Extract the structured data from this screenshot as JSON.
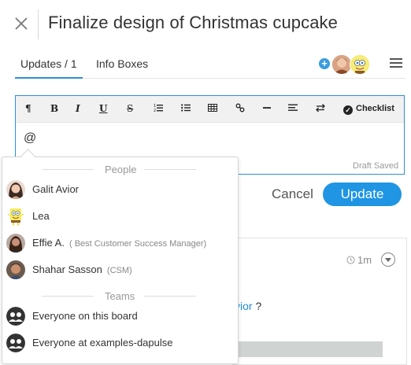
{
  "header": {
    "title": "Finalize design of Christmas cupcake"
  },
  "tabs": [
    {
      "label": "Updates / 1",
      "active": true
    },
    {
      "label": "Info Boxes",
      "active": false
    }
  ],
  "subscribers": {
    "add_symbol": "+"
  },
  "editor": {
    "toolbar": {
      "paragraph": "¶",
      "bold": "B",
      "italic": "I",
      "underline": "U",
      "strike": "S",
      "ordered_list": "≡",
      "bullet_list": "☰",
      "table": "▦",
      "link": "🔗",
      "hr": "—",
      "align": "≡",
      "direction": "⇄",
      "checklist_label": "Checklist"
    },
    "value": "@",
    "status": "Draft Saved"
  },
  "actions": {
    "cancel_label": "Cancel",
    "update_label": "Update"
  },
  "card": {
    "time": "1m",
    "text_prefix": "",
    "text_link": "vior",
    "text_suffix": " ?"
  },
  "mentions": {
    "people_heading": "People",
    "teams_heading": "Teams",
    "people": [
      {
        "name": "Galit Avior",
        "title": ""
      },
      {
        "name": "Lea",
        "title": ""
      },
      {
        "name": "Effie A.",
        "title": "( Best Customer Success Manager)"
      },
      {
        "name": "Shahar Sasson",
        "title": "(CSM)"
      }
    ],
    "teams": [
      {
        "name": "Everyone on this board"
      },
      {
        "name": "Everyone at examples-dapulse"
      }
    ]
  },
  "colors": {
    "accent": "#1f95e3",
    "link": "#1f8fd8"
  }
}
